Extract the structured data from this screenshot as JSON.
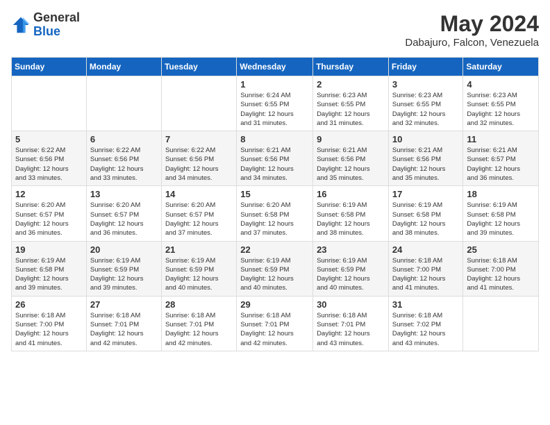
{
  "header": {
    "logo_general": "General",
    "logo_blue": "Blue",
    "month_year": "May 2024",
    "location": "Dabajuro, Falcon, Venezuela"
  },
  "days_of_week": [
    "Sunday",
    "Monday",
    "Tuesday",
    "Wednesday",
    "Thursday",
    "Friday",
    "Saturday"
  ],
  "weeks": [
    [
      {
        "num": "",
        "info": ""
      },
      {
        "num": "",
        "info": ""
      },
      {
        "num": "",
        "info": ""
      },
      {
        "num": "1",
        "info": "Sunrise: 6:24 AM\nSunset: 6:55 PM\nDaylight: 12 hours\nand 31 minutes."
      },
      {
        "num": "2",
        "info": "Sunrise: 6:23 AM\nSunset: 6:55 PM\nDaylight: 12 hours\nand 31 minutes."
      },
      {
        "num": "3",
        "info": "Sunrise: 6:23 AM\nSunset: 6:55 PM\nDaylight: 12 hours\nand 32 minutes."
      },
      {
        "num": "4",
        "info": "Sunrise: 6:23 AM\nSunset: 6:55 PM\nDaylight: 12 hours\nand 32 minutes."
      }
    ],
    [
      {
        "num": "5",
        "info": "Sunrise: 6:22 AM\nSunset: 6:56 PM\nDaylight: 12 hours\nand 33 minutes."
      },
      {
        "num": "6",
        "info": "Sunrise: 6:22 AM\nSunset: 6:56 PM\nDaylight: 12 hours\nand 33 minutes."
      },
      {
        "num": "7",
        "info": "Sunrise: 6:22 AM\nSunset: 6:56 PM\nDaylight: 12 hours\nand 34 minutes."
      },
      {
        "num": "8",
        "info": "Sunrise: 6:21 AM\nSunset: 6:56 PM\nDaylight: 12 hours\nand 34 minutes."
      },
      {
        "num": "9",
        "info": "Sunrise: 6:21 AM\nSunset: 6:56 PM\nDaylight: 12 hours\nand 35 minutes."
      },
      {
        "num": "10",
        "info": "Sunrise: 6:21 AM\nSunset: 6:56 PM\nDaylight: 12 hours\nand 35 minutes."
      },
      {
        "num": "11",
        "info": "Sunrise: 6:21 AM\nSunset: 6:57 PM\nDaylight: 12 hours\nand 36 minutes."
      }
    ],
    [
      {
        "num": "12",
        "info": "Sunrise: 6:20 AM\nSunset: 6:57 PM\nDaylight: 12 hours\nand 36 minutes."
      },
      {
        "num": "13",
        "info": "Sunrise: 6:20 AM\nSunset: 6:57 PM\nDaylight: 12 hours\nand 36 minutes."
      },
      {
        "num": "14",
        "info": "Sunrise: 6:20 AM\nSunset: 6:57 PM\nDaylight: 12 hours\nand 37 minutes."
      },
      {
        "num": "15",
        "info": "Sunrise: 6:20 AM\nSunset: 6:58 PM\nDaylight: 12 hours\nand 37 minutes."
      },
      {
        "num": "16",
        "info": "Sunrise: 6:19 AM\nSunset: 6:58 PM\nDaylight: 12 hours\nand 38 minutes."
      },
      {
        "num": "17",
        "info": "Sunrise: 6:19 AM\nSunset: 6:58 PM\nDaylight: 12 hours\nand 38 minutes."
      },
      {
        "num": "18",
        "info": "Sunrise: 6:19 AM\nSunset: 6:58 PM\nDaylight: 12 hours\nand 39 minutes."
      }
    ],
    [
      {
        "num": "19",
        "info": "Sunrise: 6:19 AM\nSunset: 6:58 PM\nDaylight: 12 hours\nand 39 minutes."
      },
      {
        "num": "20",
        "info": "Sunrise: 6:19 AM\nSunset: 6:59 PM\nDaylight: 12 hours\nand 39 minutes."
      },
      {
        "num": "21",
        "info": "Sunrise: 6:19 AM\nSunset: 6:59 PM\nDaylight: 12 hours\nand 40 minutes."
      },
      {
        "num": "22",
        "info": "Sunrise: 6:19 AM\nSunset: 6:59 PM\nDaylight: 12 hours\nand 40 minutes."
      },
      {
        "num": "23",
        "info": "Sunrise: 6:19 AM\nSunset: 6:59 PM\nDaylight: 12 hours\nand 40 minutes."
      },
      {
        "num": "24",
        "info": "Sunrise: 6:18 AM\nSunset: 7:00 PM\nDaylight: 12 hours\nand 41 minutes."
      },
      {
        "num": "25",
        "info": "Sunrise: 6:18 AM\nSunset: 7:00 PM\nDaylight: 12 hours\nand 41 minutes."
      }
    ],
    [
      {
        "num": "26",
        "info": "Sunrise: 6:18 AM\nSunset: 7:00 PM\nDaylight: 12 hours\nand 41 minutes."
      },
      {
        "num": "27",
        "info": "Sunrise: 6:18 AM\nSunset: 7:01 PM\nDaylight: 12 hours\nand 42 minutes."
      },
      {
        "num": "28",
        "info": "Sunrise: 6:18 AM\nSunset: 7:01 PM\nDaylight: 12 hours\nand 42 minutes."
      },
      {
        "num": "29",
        "info": "Sunrise: 6:18 AM\nSunset: 7:01 PM\nDaylight: 12 hours\nand 42 minutes."
      },
      {
        "num": "30",
        "info": "Sunrise: 6:18 AM\nSunset: 7:01 PM\nDaylight: 12 hours\nand 43 minutes."
      },
      {
        "num": "31",
        "info": "Sunrise: 6:18 AM\nSunset: 7:02 PM\nDaylight: 12 hours\nand 43 minutes."
      },
      {
        "num": "",
        "info": ""
      }
    ]
  ]
}
